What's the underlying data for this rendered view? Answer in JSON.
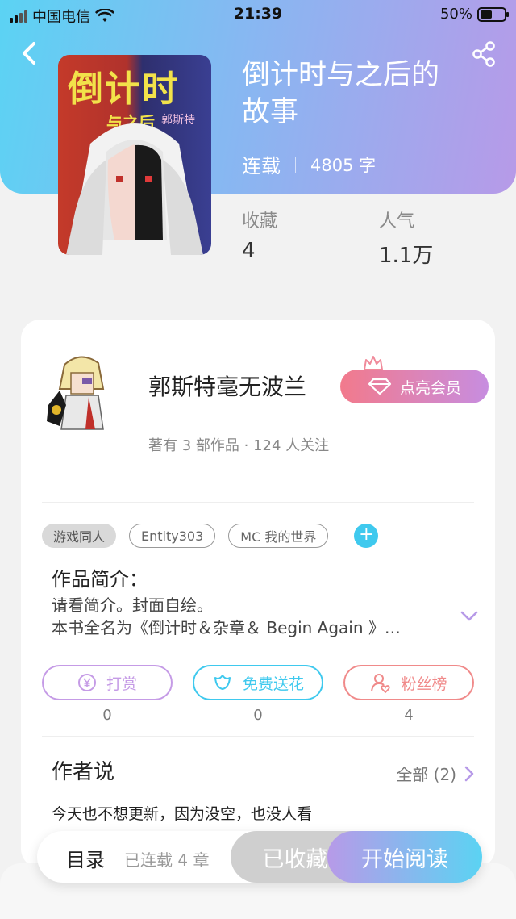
{
  "status_bar": {
    "carrier": "中国电信",
    "time": "21:39",
    "battery": "50%",
    "battery_level": 0.5
  },
  "book": {
    "cover_title": "倒计时",
    "cover_subtitle": "与之后",
    "cover_author": "郭斯特",
    "title_line1": "倒计时与之后的",
    "title_line2": "故事",
    "status": "连载",
    "word_count": "4805 字",
    "stats": [
      {
        "label": "收藏",
        "value": "4"
      },
      {
        "label": "人气",
        "value": "1.1万"
      }
    ]
  },
  "author": {
    "name": "郭斯特毫无波兰",
    "vip_label": "点亮会员",
    "stats": "著有 3 部作品 · 124 人关注"
  },
  "tags": [
    {
      "label": "游戏同人",
      "style": "filled"
    },
    {
      "label": "Entity303",
      "style": "outline"
    },
    {
      "label": "MC 我的世界",
      "style": "outline"
    }
  ],
  "intro": {
    "heading": "作品简介：",
    "line1": "请看简介。封面自绘。",
    "line2": "本书全名为《倒计时＆杂章＆ Begin Again 》…"
  },
  "actions": [
    {
      "label": "打赏",
      "count": "0",
      "color": "#c59be6",
      "icon": "yen-icon"
    },
    {
      "label": "免费送花",
      "count": "0",
      "color": "#3fc9ee",
      "icon": "flower-icon"
    },
    {
      "label": "粉丝榜",
      "count": "4",
      "color": "#f08a8a",
      "icon": "fans-icon"
    }
  ],
  "author_says": {
    "heading": "作者说",
    "all_label": "全部 (2)",
    "text": "今天也不想更新，因为没空，也没人看"
  },
  "bottom_bar": {
    "toc": "目录",
    "chapters": "已连载 4 章",
    "favorited": "已收藏",
    "start_reading": "开始阅读"
  }
}
